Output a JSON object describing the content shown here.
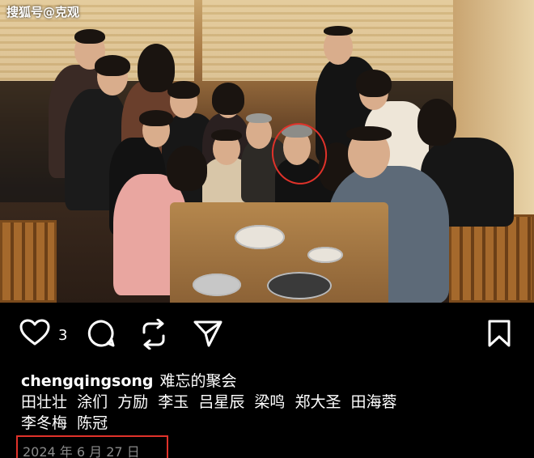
{
  "watermark": "搜狐号@克观",
  "post": {
    "like_count": "3",
    "username": "chengqingsong",
    "caption_text": "难忘的聚会",
    "tags_line1": "田壮壮  涂们  方励  李玉  吕星辰  梁鸣  郑大圣  田海蓉",
    "tags_line2": "李冬梅  陈冠",
    "date": "2024 年 6 月 27 日"
  },
  "icons": {
    "like": "heart-icon",
    "comment": "comment-icon",
    "repost": "repost-icon",
    "share": "send-icon",
    "save": "bookmark-icon"
  },
  "colors": {
    "background": "#000000",
    "highlight": "#e0322a",
    "date_text": "#8a8a8a"
  }
}
